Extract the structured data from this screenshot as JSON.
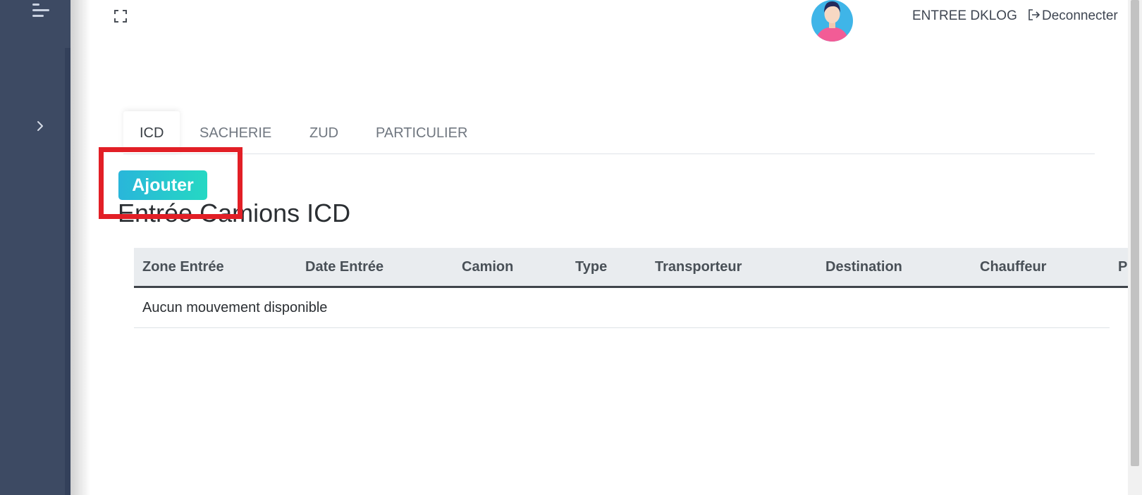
{
  "header": {
    "user_name": "ENTREE DKLOG",
    "logout_label": "Deconnecter"
  },
  "tabs": [
    {
      "label": "ICD",
      "active": true
    },
    {
      "label": "SACHERIE",
      "active": false
    },
    {
      "label": "ZUD",
      "active": false
    },
    {
      "label": "PARTICULIER",
      "active": false
    }
  ],
  "main": {
    "add_button_label": "Ajouter",
    "title": "Entrée Camions ICD"
  },
  "table": {
    "columns": [
      "Zone Entrée",
      "Date Entrée",
      "Camion",
      "Type",
      "Transporteur",
      "Destination",
      "Chauffeur",
      "P"
    ],
    "empty_message": "Aucun mouvement disponible"
  },
  "colors": {
    "sidebar": "#3d4a63",
    "button_gradient_start": "#29b6da",
    "button_gradient_end": "#25d8c3",
    "highlight": "#e21f26"
  },
  "icons": {
    "menu": "menu-icon",
    "chevron": "chevron-right-icon",
    "fullscreen": "fullscreen-icon",
    "logout": "logout-icon"
  }
}
